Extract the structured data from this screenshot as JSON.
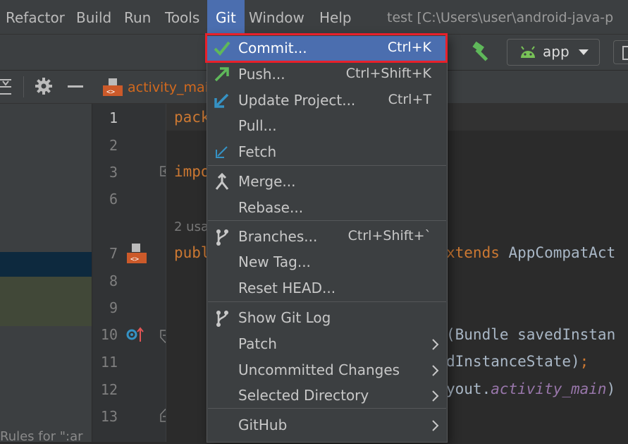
{
  "menubar": {
    "items": [
      "Refactor",
      "Build",
      "Run",
      "Tools",
      "Git",
      "Window",
      "Help"
    ],
    "active": "Git",
    "window_title": "test [C:\\Users\\user\\android-java-p"
  },
  "toolbar": {
    "run_config": "app",
    "hammer_color": "#5fb85a",
    "android_color": "#78c257"
  },
  "editor_tab": {
    "label": "activity_main"
  },
  "left_panel": {
    "footer": "Rules for \":ar"
  },
  "gutter": {
    "line_numbers": [
      "1",
      "2",
      "3",
      "6",
      "7",
      "8",
      "9",
      "10",
      "11",
      "12",
      "13"
    ]
  },
  "code": {
    "line1": "pack",
    "line3": "impo",
    "usages_hint": "2 usa",
    "line7_start": "publ",
    "line7_end_kw": "xtends",
    "line7_end": " AppCompatAct",
    "line10": "(Bundle savedInstan",
    "line11": "dInstanceState)",
    "line11_semi": ";",
    "line12_a": "yout.",
    "line12_b": "activity_main",
    "line12_c": ")"
  },
  "git_menu": {
    "items": [
      {
        "label": "Commit...",
        "shortcut": "Ctrl+K",
        "icon": "check-icon",
        "highlighted": true
      },
      {
        "label": "Push...",
        "shortcut": "Ctrl+Shift+K",
        "icon": "push-arrow-icon"
      },
      {
        "label": "Update Project...",
        "shortcut": "Ctrl+T",
        "icon": "update-arrow-icon"
      },
      {
        "label": "Pull...",
        "shortcut": ""
      },
      {
        "label": "Fetch",
        "shortcut": "",
        "icon": "fetch-icon"
      },
      {
        "label": "Merge...",
        "shortcut": "",
        "icon": "merge-icon"
      },
      {
        "label": "Rebase...",
        "shortcut": ""
      },
      {
        "label": "Branches...",
        "shortcut": "Ctrl+Shift+`",
        "icon": "branch-icon"
      },
      {
        "label": "New Tag...",
        "shortcut": ""
      },
      {
        "label": "Reset HEAD...",
        "shortcut": ""
      },
      {
        "label": "Show Git Log",
        "shortcut": "",
        "icon": "git-log-icon"
      },
      {
        "label": "Patch",
        "shortcut": "",
        "submenu": true
      },
      {
        "label": "Uncommitted Changes",
        "shortcut": "",
        "submenu": true
      },
      {
        "label": "Selected Directory",
        "shortcut": "",
        "submenu": true
      },
      {
        "label": "GitHub",
        "shortcut": "",
        "submenu": true
      }
    ],
    "highlight_color": "#4b6eaf",
    "annotation_color": "#e8202a"
  }
}
